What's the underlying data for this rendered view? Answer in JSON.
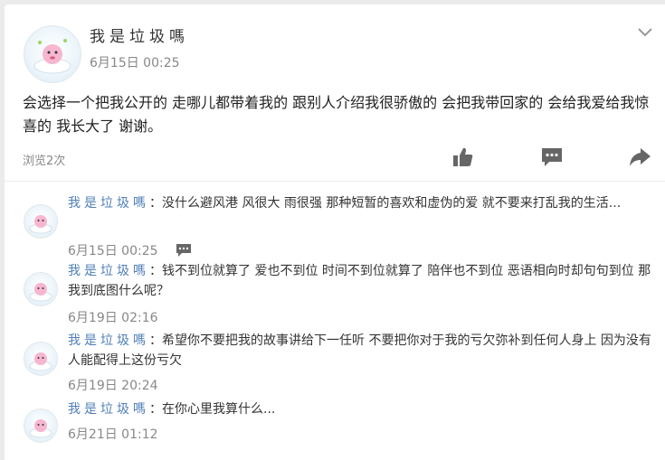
{
  "post": {
    "author": "我是垃圾嗎",
    "time": "6月15日 00:25",
    "text": "会选择一个把我公开的 走哪儿都带着我的 跟别人介绍我很骄傲的 会把我带回家的 会给我爱给我惊喜的 我长大了 谢谢。",
    "views": "浏览2次",
    "icons": [
      "chevron-down-icon",
      "thumbs-up-icon",
      "comment-icon",
      "share-icon"
    ]
  },
  "comments": [
    {
      "author": "我是垃圾嗎",
      "separator": "：",
      "text": "没什么避风港 风很大 雨很强 那种短暂的喜欢和虚伪的爱 就不要来打乱我的生活...",
      "time": "6月15日 00:25"
    },
    {
      "author": "我是垃圾嗎",
      "separator": "：",
      "text": "钱不到位就算了 爱也不到位 时间不到位就算了 陪伴也不到位 恶语相向时却句句到位 那我到底图什么呢？",
      "time": "6月19日 02:16"
    },
    {
      "author": "我是垃圾嗎",
      "separator": "：",
      "text": "希望你不要把我的故事讲给下一任听 不要把你对于我的亏欠弥补到任何人身上 因为没有人能配得上这份亏欠",
      "time": "6月19日 20:24"
    },
    {
      "author": "我是垃圾嗎",
      "separator": "：",
      "text": "在你心里我算什么...",
      "time": "6月21日 01:12"
    }
  ],
  "colors": {
    "name_link": "#4f7fb8",
    "icon": "#666666",
    "background": "#ebebeb"
  }
}
